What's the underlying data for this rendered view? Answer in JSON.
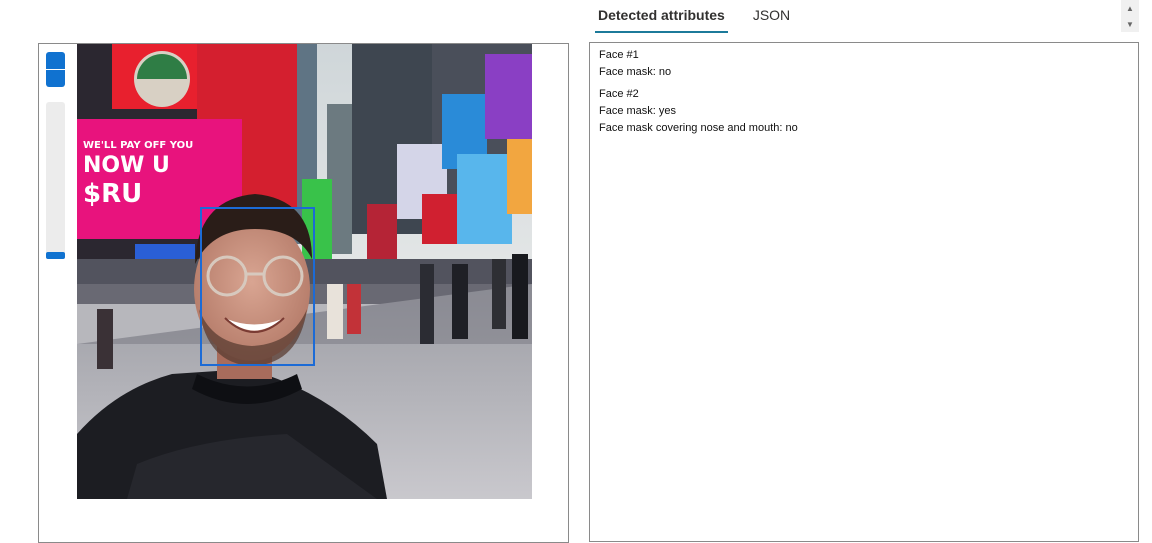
{
  "tabs": [
    {
      "label": "Detected attributes",
      "active": true
    },
    {
      "label": "JSON",
      "active": false
    }
  ],
  "scroll": {
    "up_icon": "chevron-up-icon",
    "down_icon": "chevron-down-icon"
  },
  "zoom": {
    "in_icon": "zoom-in",
    "out_icon": "zoom-out",
    "level_fraction": 0.0
  },
  "results": {
    "faces": [
      {
        "title": "Face #1",
        "lines": [
          "Face mask: no"
        ]
      },
      {
        "title": "Face #2",
        "lines": [
          "Face mask: yes",
          "Face mask covering nose and mouth: no"
        ]
      }
    ]
  },
  "colors": {
    "accent": "#1072d0",
    "tab_underline": "#1c7a9a",
    "face_box": "#1c6bd6"
  }
}
